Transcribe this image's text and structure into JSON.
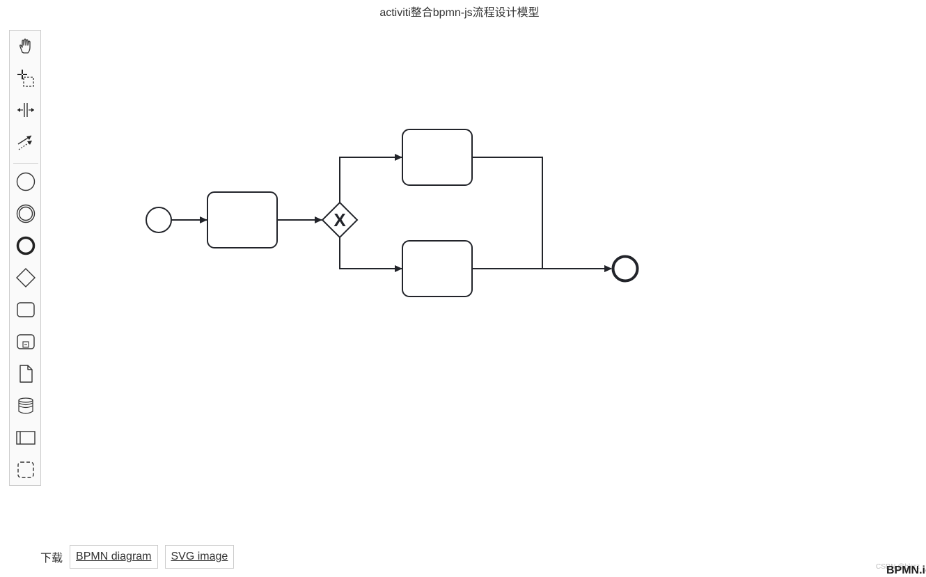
{
  "page": {
    "title": "activiti整合bpmn-js流程设计模型"
  },
  "palette": {
    "tools": [
      {
        "name": "hand-tool",
        "icon": "hand-icon"
      },
      {
        "name": "lasso-tool",
        "icon": "lasso-icon"
      },
      {
        "name": "space-tool",
        "icon": "space-tool-icon"
      },
      {
        "name": "global-connect-tool",
        "icon": "connect-arrow-icon"
      },
      {
        "name": "create-start-event",
        "icon": "start-event-icon"
      },
      {
        "name": "create-intermediate-event",
        "icon": "intermediate-event-icon"
      },
      {
        "name": "create-end-event",
        "icon": "end-event-icon"
      },
      {
        "name": "create-gateway",
        "icon": "gateway-icon"
      },
      {
        "name": "create-task",
        "icon": "task-icon"
      },
      {
        "name": "create-subprocess",
        "icon": "subprocess-icon"
      },
      {
        "name": "create-data-object",
        "icon": "data-object-icon"
      },
      {
        "name": "create-data-store",
        "icon": "data-store-icon"
      },
      {
        "name": "create-pool",
        "icon": "pool-icon"
      },
      {
        "name": "create-group",
        "icon": "group-icon"
      }
    ]
  },
  "diagram": {
    "stroke_color": "#22242a",
    "gateway_marker": "X",
    "elements": [
      "start-event",
      "task-1",
      "exclusive-gateway",
      "task-upper",
      "task-lower",
      "end-event"
    ]
  },
  "downloads": {
    "label": "下载",
    "bpmn_button": "BPMN diagram",
    "svg_button": "SVG image"
  },
  "footer": {
    "watermark": "CSDN @blgrz",
    "logo": "BPMN.io"
  }
}
